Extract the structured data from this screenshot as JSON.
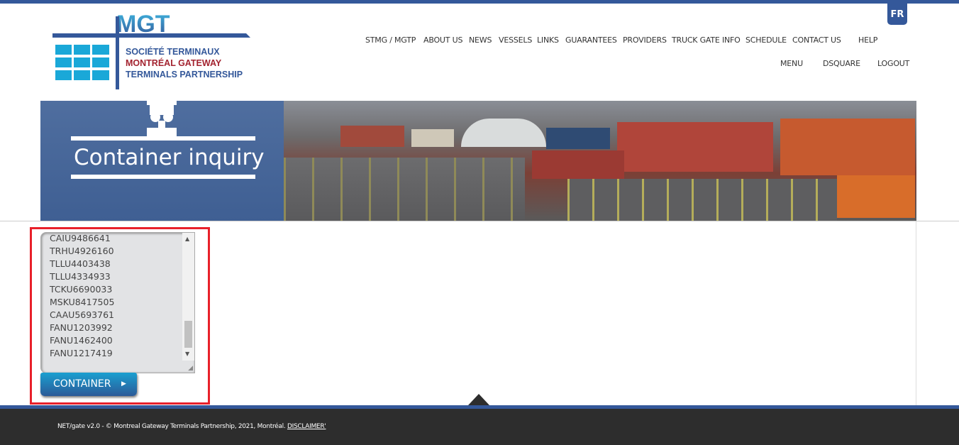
{
  "brand": {
    "logo_mark": "MGT",
    "logo_line1": "SOCIÉTÉ TERMINAUX",
    "logo_line2": "MONTRÉAL GATEWAY",
    "logo_line3": "TERMINALS PARTNERSHIP",
    "colors": {
      "primary": "#34589a",
      "accent_cyan": "#1aa8d8",
      "accent_red": "#a3232f"
    }
  },
  "language_toggle": "FR",
  "nav": {
    "primary": [
      "STMG / MGTP",
      "ABOUT US",
      "NEWS",
      "VESSELS",
      "LINKS",
      "GUARANTEES",
      "PROVIDERS",
      "TRUCK GATE INFO",
      "SCHEDULE",
      "CONTACT US",
      "HELP"
    ],
    "secondary": [
      "MENU",
      "DSQUARE",
      "LOGOUT"
    ]
  },
  "banner": {
    "title": "Container inquiry",
    "icon": "crane-icon"
  },
  "form": {
    "containers": [
      "CAIU9486641",
      "TRHU4926160",
      "TLLU4403438",
      "TLLU4334933",
      "TCKU6690033",
      "MSKU8417505",
      "CAAU5693761",
      "FANU1203992",
      "FANU1462400",
      "FANU1217419"
    ],
    "submit_label": "CONTAINER",
    "submit_icon": "caret-right-icon"
  },
  "footer": {
    "text": "NET/gate v2.0 - © Montreal Gateway Terminals Partnership, 2021, Montréal. ",
    "disclaimer": "DISCLAIMER'"
  }
}
